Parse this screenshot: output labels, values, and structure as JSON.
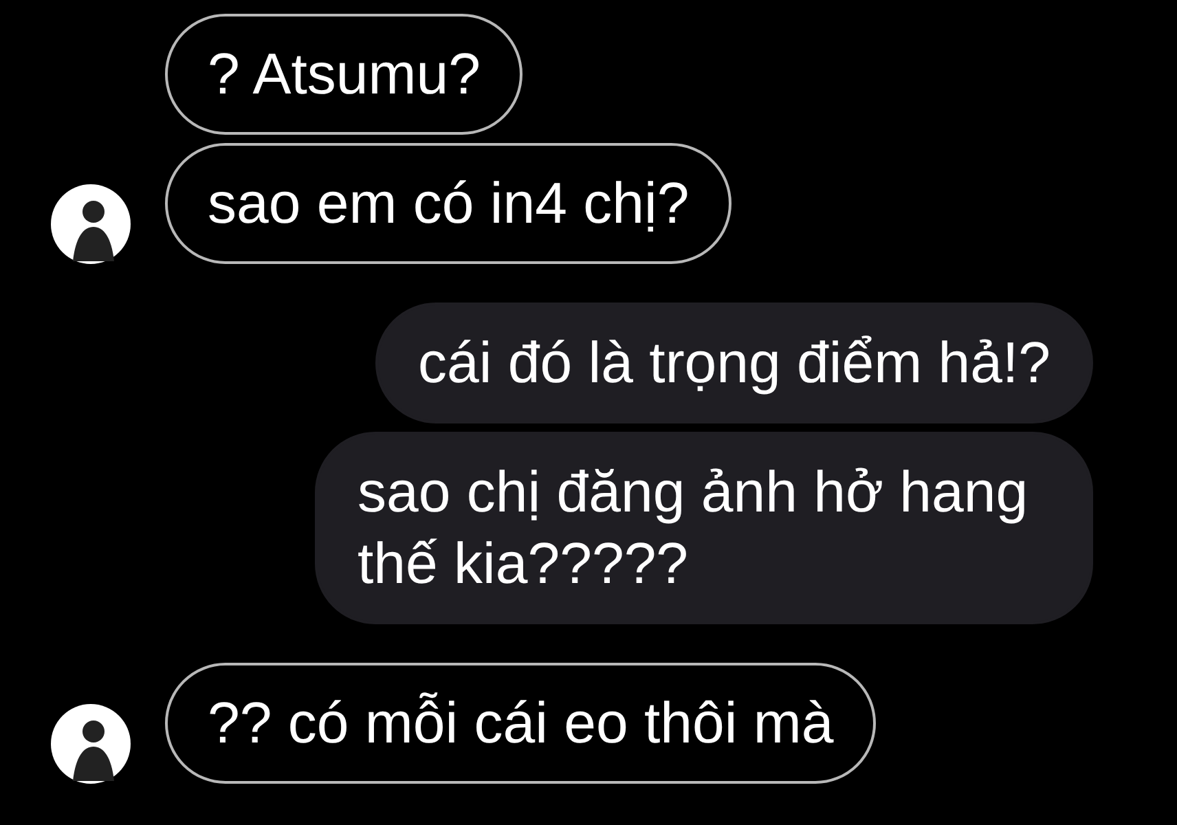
{
  "messages": [
    {
      "kind": "incoming",
      "text": "? Atsumu?",
      "avatar": false
    },
    {
      "kind": "incoming",
      "text": "sao em có in4 chị?",
      "avatar": true
    },
    {
      "kind": "outgoing",
      "text": "cái đó là trọng điểm hả!?"
    },
    {
      "kind": "outgoing",
      "text": "sao chị đăng ảnh hở hang thế kia?????"
    },
    {
      "kind": "incoming",
      "text": "?? có mỗi cái eo thôi mà",
      "avatar": true
    }
  ]
}
